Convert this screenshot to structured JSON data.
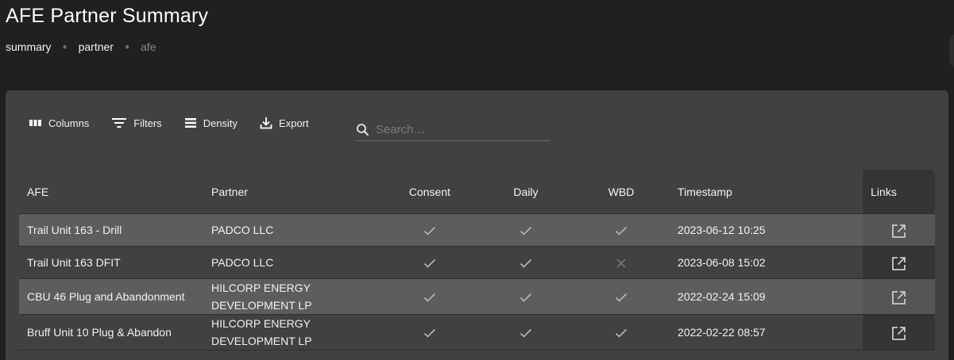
{
  "header": {
    "title": "AFE Partner Summary"
  },
  "breadcrumb": [
    "summary",
    "partner",
    "afe"
  ],
  "toolbar": {
    "columns": "Columns",
    "filters": "Filters",
    "density": "Density",
    "export": "Export",
    "search_placeholder": "Search…"
  },
  "table": {
    "headers": [
      "AFE",
      "Partner",
      "Consent",
      "Daily",
      "WBD",
      "Timestamp",
      "Links"
    ],
    "rows": [
      {
        "afe": "Trail Unit 163 - Drill",
        "partner": [
          "PADCO LLC"
        ],
        "consent": true,
        "daily": true,
        "wbd": true,
        "timestamp": "2023-06-12 10:25"
      },
      {
        "afe": "Trail Unit 163 DFIT",
        "partner": [
          "PADCO LLC"
        ],
        "consent": true,
        "daily": true,
        "wbd": false,
        "timestamp": "2023-06-08 15:02"
      },
      {
        "afe": "CBU 46 Plug and Abandonment",
        "partner": [
          "HILCORP ENERGY",
          "DEVELOPMENT LP"
        ],
        "consent": true,
        "daily": true,
        "wbd": true,
        "timestamp": "2022-02-24 15:09"
      },
      {
        "afe": "Bruff Unit 10 Plug & Abandon",
        "partner": [
          "HILCORP ENERGY",
          "DEVELOPMENT LP"
        ],
        "consent": true,
        "daily": true,
        "wbd": true,
        "timestamp": "2022-02-22 08:57"
      }
    ]
  }
}
